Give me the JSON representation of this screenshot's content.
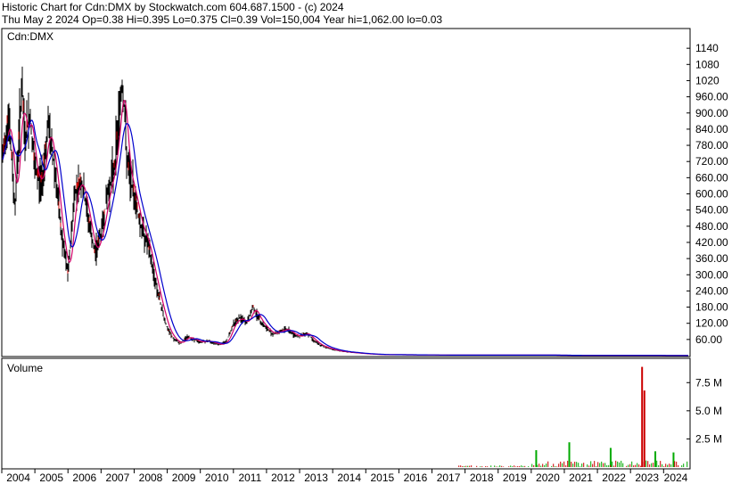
{
  "header": {
    "title": "Historic Chart for Cdn:DMX by Stockwatch.com 604.687.1500 - (c) 2024",
    "quote": "Thu May  2 2024   Op=0.38  Hi=0.395  Lo=0.375  Cl=0.39  Vol=150,004  Year hi=1,062.00  lo=0.03"
  },
  "chart_data": [
    {
      "type": "line",
      "title": "Cdn:DMX",
      "y_ticks": [
        "1140",
        "1080",
        "1020",
        "960.00",
        "900.00",
        "840.00",
        "780.00",
        "720.00",
        "660.00",
        "600.00",
        "540.00",
        "480.00",
        "420.00",
        "360.00",
        "300.00",
        "240.00",
        "180.00",
        "120.00",
        "60.00"
      ],
      "ylim": [
        0,
        1200
      ],
      "x_ticks": [
        "2004",
        "2005",
        "2006",
        "2007",
        "2008",
        "2009",
        "2010",
        "2011",
        "2012",
        "2013",
        "2014",
        "2015",
        "2016",
        "2017",
        "2018",
        "2019",
        "2020",
        "2021",
        "2022",
        "2023",
        "2024"
      ],
      "series": [
        {
          "name": "",
          "color": "#000000",
          "x": [
            2003.5,
            2003.7,
            2003.9,
            2004.1,
            2004.2,
            2004.35,
            2004.5,
            2004.7,
            2004.9,
            2005.1,
            2005.3,
            2005.5,
            2005.7,
            2005.9,
            2006.1,
            2006.3,
            2006.5,
            2006.7,
            2006.9,
            2007.05,
            2007.15,
            2007.3,
            2007.5,
            2007.7,
            2007.9,
            2008.1,
            2008.3,
            2008.5,
            2008.7,
            2008.9,
            2009.1,
            2009.3,
            2009.5,
            2009.7,
            2009.9,
            2010.1,
            2010.3,
            2010.5,
            2010.7,
            2010.9,
            2011.1,
            2011.3,
            2011.5,
            2011.7,
            2011.9,
            2012.1,
            2012.3,
            2012.5,
            2012.7,
            2012.9,
            2013.1,
            2013.3,
            2013.5,
            2013.8,
            2014.2,
            2014.6,
            2015.0,
            2016.0,
            2017.0,
            2018.0,
            2019.0,
            2020.0,
            2021.0,
            2022.0,
            2023.0,
            2024.3
          ],
          "y": [
            700,
            900,
            550,
            1000,
            800,
            900,
            680,
            640,
            850,
            700,
            450,
            300,
            600,
            650,
            520,
            380,
            450,
            600,
            700,
            900,
            1020,
            700,
            600,
            480,
            420,
            300,
            190,
            100,
            60,
            45,
            70,
            60,
            50,
            55,
            48,
            40,
            55,
            120,
            140,
            120,
            180,
            130,
            100,
            80,
            90,
            100,
            80,
            70,
            85,
            60,
            40,
            30,
            22,
            15,
            10,
            6,
            4,
            3,
            2,
            2,
            2,
            2,
            1,
            1,
            1,
            0.4
          ]
        }
      ],
      "moving_averages": [
        {
          "color": "#d4006a"
        },
        {
          "color": "#0000cc"
        }
      ]
    },
    {
      "type": "bar",
      "title": "Volume",
      "y_ticks": [
        "7.5 M",
        "5.0 M",
        "2.5 M"
      ],
      "ylim": [
        0,
        9500000
      ],
      "notable_bars": [
        {
          "x": 2022.85,
          "value": 8900000,
          "color": "#cc0000"
        },
        {
          "x": 2022.92,
          "value": 6800000,
          "color": "#cc0000"
        },
        {
          "x": 2020.65,
          "value": 2200000,
          "color": "#00aa00"
        },
        {
          "x": 2019.65,
          "value": 1500000,
          "color": "#00aa00"
        },
        {
          "x": 2021.9,
          "value": 1700000,
          "color": "#00aa00"
        },
        {
          "x": 2023.25,
          "value": 1400000,
          "color": "#00aa00"
        },
        {
          "x": 2023.8,
          "value": 1300000,
          "color": "#00aa00"
        }
      ]
    }
  ]
}
